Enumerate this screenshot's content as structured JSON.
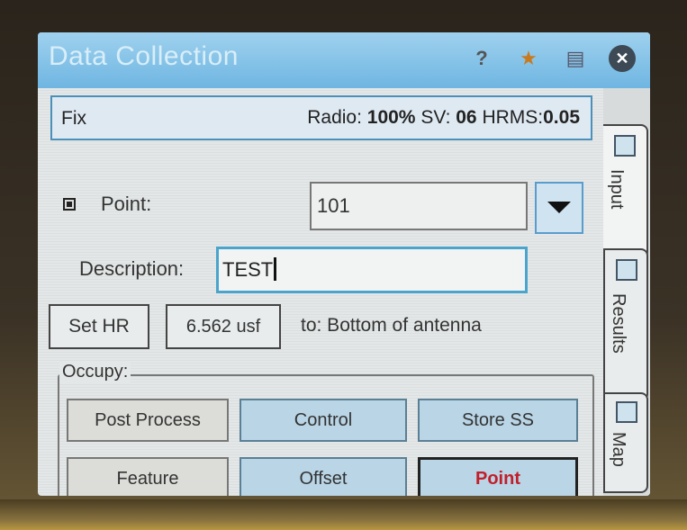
{
  "window": {
    "title": "Data Collection",
    "icons": [
      "help-icon",
      "star-icon",
      "pages-icon",
      "close-icon"
    ]
  },
  "status_bar": {
    "fix": "Fix",
    "radio_label": "Radio:",
    "radio_value": "100%",
    "sv_label": "SV:",
    "sv_value": "06",
    "hrms_label": "HRMS:",
    "hrms_value": "0.05"
  },
  "form": {
    "point_label": "Point:",
    "point_value": "101",
    "description_label": "Description:",
    "description_value": "TEST",
    "set_hr": "Set HR",
    "hr_value": "6.562 usf",
    "to_label": "to: Bottom of antenna"
  },
  "occupy": {
    "label": "Occupy:",
    "buttons": [
      "Post Process",
      "Control",
      "Store SS",
      "Feature",
      "Offset",
      "Point"
    ]
  },
  "side_tabs": [
    "Input",
    "Results",
    "Map"
  ]
}
